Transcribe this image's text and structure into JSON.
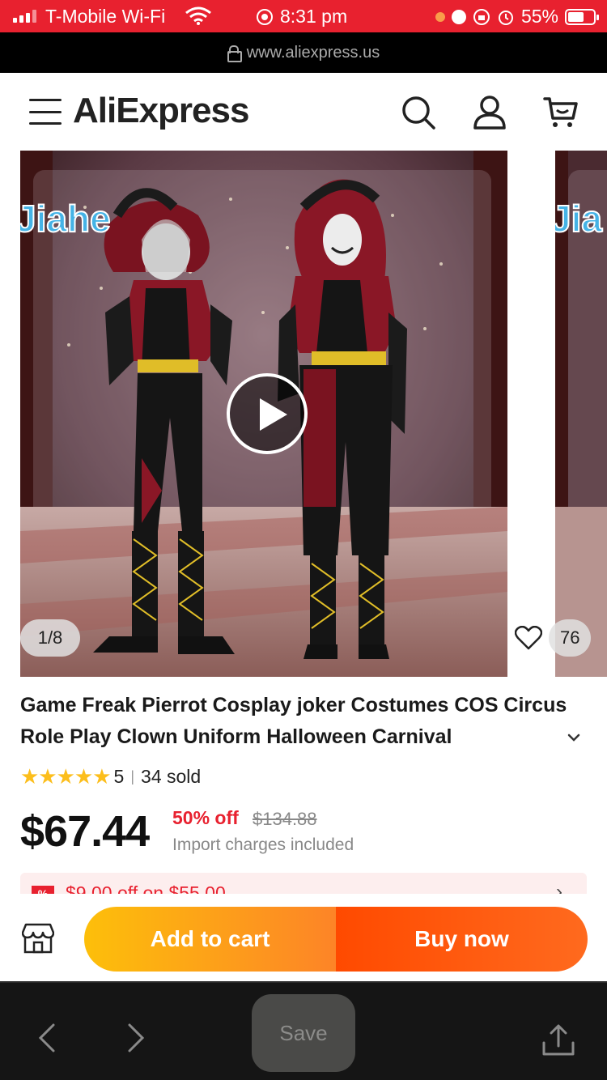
{
  "status_bar": {
    "carrier": "T-Mobile Wi-Fi",
    "time": "8:31 pm",
    "battery": "55%"
  },
  "url_bar": {
    "url": "www.aliexpress.us"
  },
  "header": {
    "logo_text": "AliExpress"
  },
  "gallery": {
    "counter": "1/8",
    "wishlist_count": "76",
    "brand_watermark": "Jiahe"
  },
  "product": {
    "title": "Game Freak Pierrot Cosplay joker Costumes COS Circus Role Play Clown Uniform Halloween Carnival",
    "rating": "5",
    "sold": "34 sold",
    "price": "$67.44",
    "discount": "50% off",
    "original_price": "$134.88",
    "import_note": "Import charges included"
  },
  "coupon": {
    "text": "$9.00 off on $55.00"
  },
  "actions": {
    "add_to_cart": "Add to cart",
    "buy_now": "Buy now"
  },
  "browser_toolbar": {
    "save_label": "Save"
  },
  "colors": {
    "brand_red": "#e8212f",
    "cart_gradient_start": "#fdbf0a",
    "buy_gradient_start": "#ff4a00",
    "star": "#fcbe1c"
  }
}
